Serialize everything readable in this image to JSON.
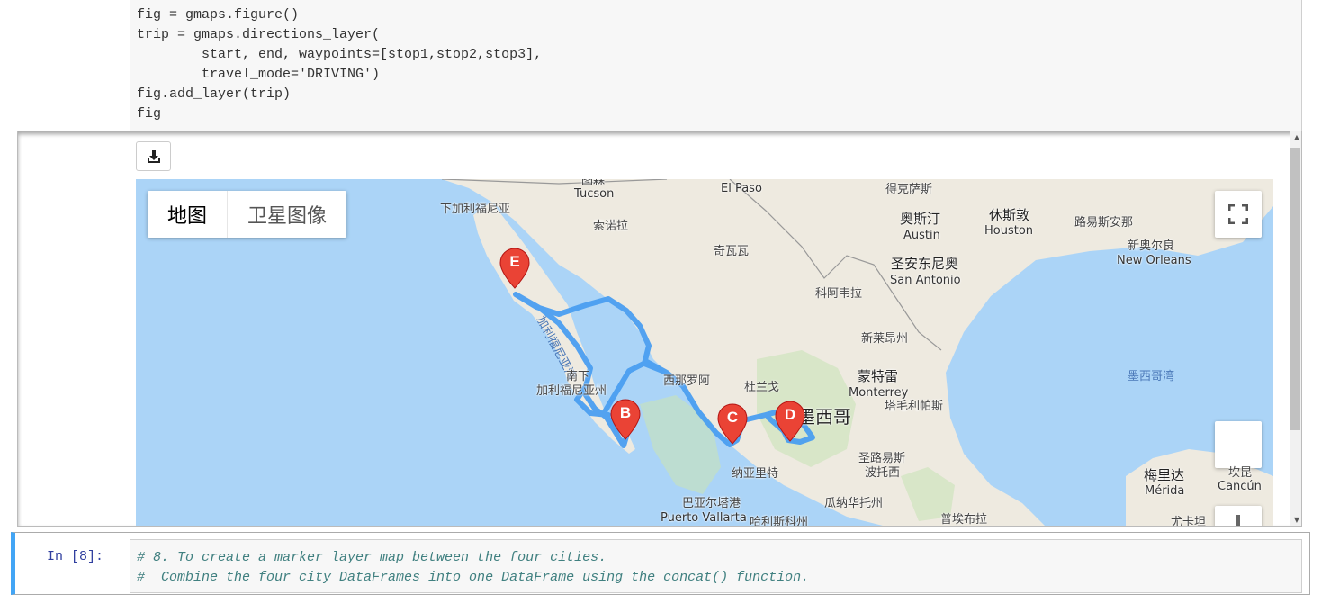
{
  "code_cell": {
    "lines": [
      "fig = gmaps.figure()",
      "trip = gmaps.directions_layer(",
      "        start, end, waypoints=[stop1,stop2,stop3],",
      "        travel_mode='DRIVING')",
      "fig.add_layer(trip)",
      "fig"
    ]
  },
  "toolbar": {
    "download_icon": "download-icon"
  },
  "map": {
    "type_buttons": [
      "地图",
      "卫星图像"
    ],
    "fullscreen_icon": "fullscreen-icon",
    "labels": [
      {
        "text": "图森",
        "kind": "city"
      },
      {
        "text": "Tucson",
        "kind": "city"
      },
      {
        "text": "El Paso",
        "kind": "city"
      },
      {
        "text": "得克萨斯",
        "kind": "region"
      },
      {
        "text": "下加利福尼亚",
        "kind": "region"
      },
      {
        "text": "索诺拉",
        "kind": "region"
      },
      {
        "text": "奥斯汀",
        "kind": "city"
      },
      {
        "text": "Austin",
        "kind": "city"
      },
      {
        "text": "休斯敦",
        "kind": "city"
      },
      {
        "text": "Houston",
        "kind": "city"
      },
      {
        "text": "路易斯安那",
        "kind": "region"
      },
      {
        "text": "新奥尔良",
        "kind": "city"
      },
      {
        "text": "New Orleans",
        "kind": "city"
      },
      {
        "text": "奇瓦瓦",
        "kind": "region"
      },
      {
        "text": "圣安东尼奥",
        "kind": "city"
      },
      {
        "text": "San Antonio",
        "kind": "city"
      },
      {
        "text": "加利福尼亚湾",
        "kind": "sea"
      },
      {
        "text": "科阿韦拉",
        "kind": "region"
      },
      {
        "text": "新莱昂州",
        "kind": "region"
      },
      {
        "text": "南下",
        "kind": "region"
      },
      {
        "text": "加利福尼亚州",
        "kind": "region"
      },
      {
        "text": "西那罗阿",
        "kind": "region"
      },
      {
        "text": "杜兰戈",
        "kind": "region"
      },
      {
        "text": "蒙特雷",
        "kind": "city"
      },
      {
        "text": "Monterrey",
        "kind": "city"
      },
      {
        "text": "墨西哥湾",
        "kind": "sea"
      },
      {
        "text": "塔毛利帕斯",
        "kind": "region"
      },
      {
        "text": "墨西哥",
        "kind": "country"
      },
      {
        "text": "圣路易斯",
        "kind": "region"
      },
      {
        "text": "波托西",
        "kind": "region"
      },
      {
        "text": "纳亚里特",
        "kind": "region"
      },
      {
        "text": "梅里达",
        "kind": "city"
      },
      {
        "text": "Mérida",
        "kind": "city"
      },
      {
        "text": "坎昆",
        "kind": "city"
      },
      {
        "text": "Cancún",
        "kind": "city"
      },
      {
        "text": "巴亚尔塔港",
        "kind": "city"
      },
      {
        "text": "Puerto Vallarta",
        "kind": "city"
      },
      {
        "text": "瓜纳华托州",
        "kind": "region"
      },
      {
        "text": "哈利斯科州",
        "kind": "region"
      },
      {
        "text": "普埃布拉",
        "kind": "region"
      },
      {
        "text": "尤卡坦",
        "kind": "region"
      }
    ],
    "markers": [
      "B",
      "C",
      "D",
      "E"
    ],
    "route_color": "#4285f4",
    "marker_color": "#ea4335"
  },
  "next_cell": {
    "prompt": "In  [8]:",
    "lines": [
      "# 8. To create a marker layer map between the four cities.",
      "#  Combine the four city DataFrames into one DataFrame using the concat() function."
    ]
  }
}
